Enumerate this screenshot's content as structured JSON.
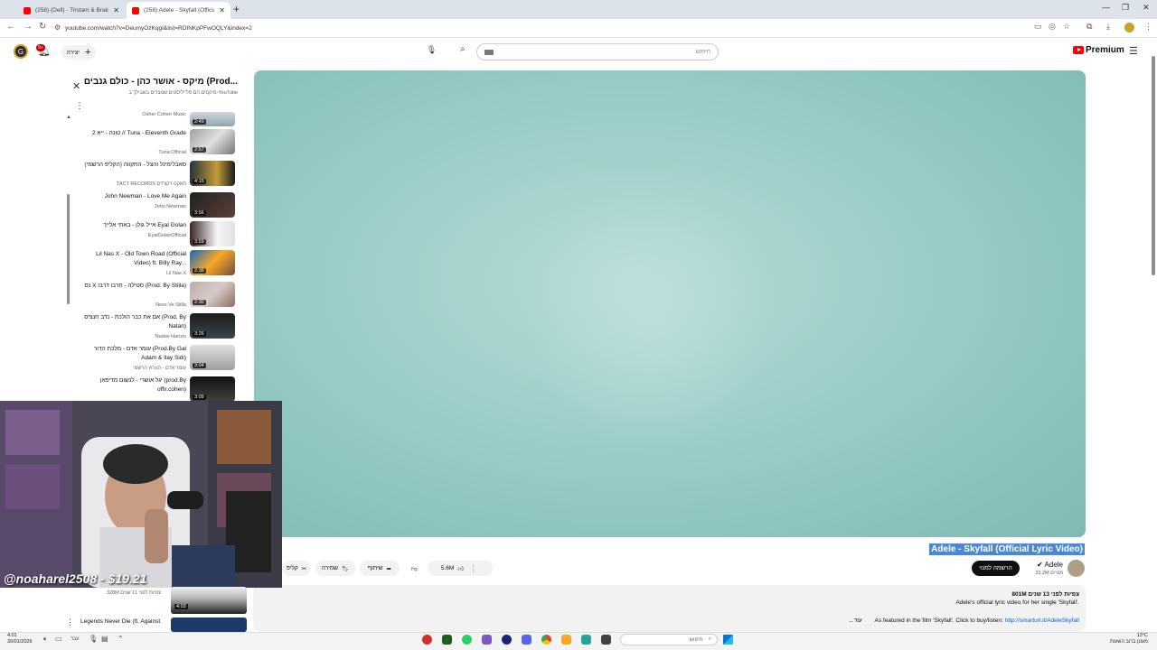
{
  "browser": {
    "tabs": [
      {
        "title": "(258) (Dell) - Tristam & Braken"
      },
      {
        "title": "(258) Adele - Skyfall (Official Ly..."
      }
    ],
    "url": "youtube.com/watch?v=DeumyOzKqgI&list=RDINKpPFwOQLY&index=2"
  },
  "header": {
    "avatar_letter": "G",
    "notif_count": "9+",
    "create_label": "יצירה",
    "search_placeholder": "חיפוש",
    "premium_label": "Premium"
  },
  "video": {
    "title": "Adele - Skyfall (Official Lyric Video)",
    "channel": "Adele",
    "subscribers": "33.2M מנויים",
    "subscribe_label": "הרשמה למנוי",
    "likes": "5.6M",
    "share_label": "שיתוף",
    "save_label": "שמירה",
    "clip_label": "קליפ",
    "views_date": "801M צפיות  לפני 13 שנים",
    "desc_line1": "Adele's official lyric video for her single 'Skyfall'.",
    "desc_line2_prefix": "As featured in the film 'Skyfall'. Click to buy/listen: ",
    "desc_link": "http://smarturl.it/AdeleSkyfall",
    "desc_more": "...עוד"
  },
  "playlist": {
    "title": "מיקס - אושר כהן - כולם גנבים (Prod...",
    "subtitle": "מיקסים הם פלייליסטים שנוצרים בשבילך ב-YouTube",
    "items": [
      {
        "title": "Osher Cohen Music",
        "channel": "",
        "duration": "2:49"
      },
      {
        "title": "טונה - ייא 2 // Tuna - Eleventh Grade",
        "channel": "Tuna Official",
        "duration": "2:57"
      },
      {
        "title": "סאבלימינל והצל - התקווה (הקליפ הרשמי)",
        "channel": "TACT RECORDS תאקט רקורדס",
        "duration": "4:15"
      },
      {
        "title": "John Newman - Love Me Again",
        "channel": "John Newman",
        "duration": "3:56"
      },
      {
        "title": "אייל גולן - באתי אלייך Eyal Golan",
        "channel": "EyalGolanOfficial",
        "duration": "3:59"
      },
      {
        "title": "Lil Nas X - Old Town Road (Official Video) ft. Billy Ray...",
        "channel": "Lil Nas X",
        "duration": "2:38"
      },
      {
        "title": "נס X סטילה - חרבו דרבו (Prod. By Stilla)",
        "channel": "Ness Ve Stilla",
        "duration": "2:30"
      },
      {
        "title": "אם את כבר הולכת - נדב חנציס (Prod. By Natan)",
        "channel": "Nadav Hanzis",
        "duration": "3:26"
      },
      {
        "title": "עומר אדם - מלכת הדור (Prod.By Gal Adam & Ilay Sidi)",
        "channel": "עומר אדם - הערוץ הרשמי",
        "duration": "3:04"
      },
      {
        "title": "יגל אושרי - לנשום מדיפאן (prod.By offir.cohen)",
        "channel": "",
        "duration": "3:09"
      }
    ]
  },
  "webcam": {
    "tag": "@noaharel2508 - $19.21"
  },
  "related": {
    "views": "328M צפיות  לפני 11 שנים",
    "duration": "4:03",
    "next_title": "Legends Never Die (ft. Against"
  },
  "taskbar": {
    "time": "4:01",
    "date": "30/01/2026",
    "search_label": "חיפוש",
    "weather": "13°C",
    "weather_desc": "מעונן ברוב השעות",
    "lang": "עבר"
  },
  "colors": {
    "accent": "#ff0000",
    "player_bg": "#8fc7c1",
    "selection": "#4a87d6"
  }
}
